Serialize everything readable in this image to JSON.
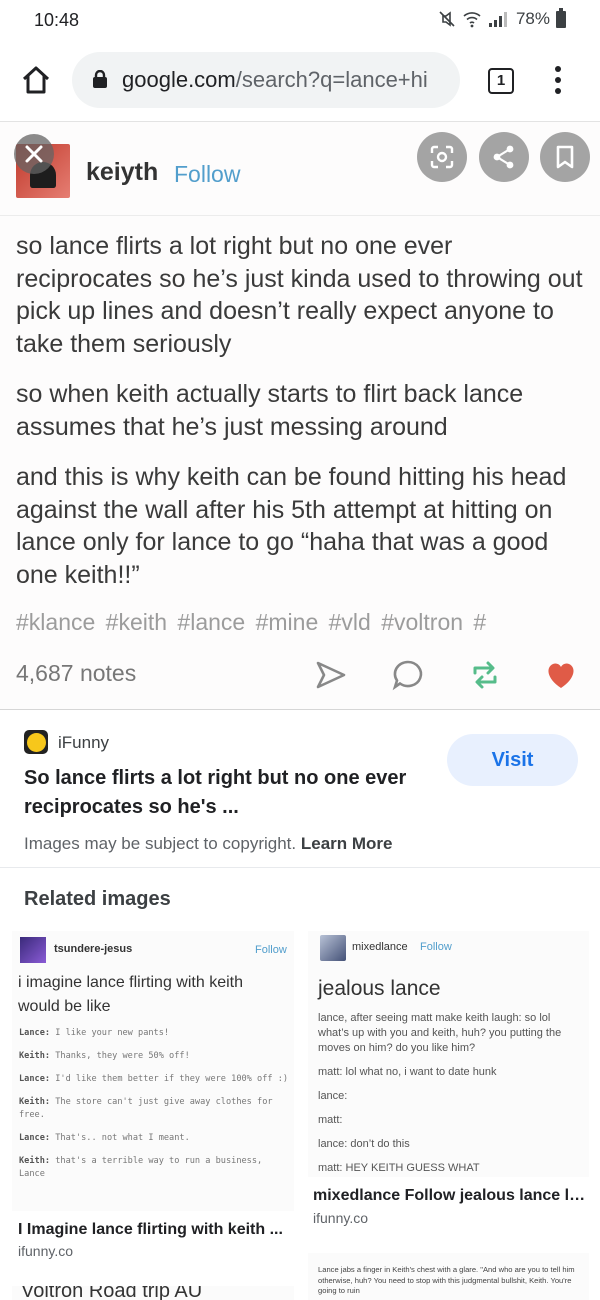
{
  "status_bar": {
    "time": "10:48",
    "battery": "78%"
  },
  "browser": {
    "url_host": "google.com",
    "url_path": "/search?q=lance+hi",
    "tab_count": "1"
  },
  "post": {
    "username": "keiyth",
    "follow_label": "Follow",
    "paragraphs": [
      "so lance flirts a lot right but no one ever reciprocates so he’s just kinda used to throwing out pick up lines and doesn’t really expect anyone to take them seriously",
      "so when keith actually starts to flirt back lance assumes that he’s just messing around",
      "and this is why keith can be found hitting his head against the wall after his 5th attempt at hitting on lance only for lance to go “haha that was a good one keith!!”"
    ],
    "tags": "#klance #keith #lance #mine #vld #voltron #",
    "notes": "4,687 notes"
  },
  "result": {
    "source": "iFunny",
    "title": "So lance flirts a lot right but no one ever reciprocates so he's ...",
    "visit_label": "Visit",
    "copyright_text": "Images may be subject to copyright.",
    "learn_more": "Learn More"
  },
  "related": {
    "heading": "Related images",
    "items": [
      {
        "user": "tsundere-jesus",
        "follow": "Follow",
        "heading": "i imagine lance flirting with keith would be like",
        "lines": [
          {
            "speaker": "Lance:",
            "text": "I like your new pants!"
          },
          {
            "speaker": "Keith:",
            "text": "Thanks, they were 50% off!"
          },
          {
            "speaker": "Lance:",
            "text": "I'd like them better if they were 100% off :)"
          },
          {
            "speaker": "Keith:",
            "text": "The store can't just give away clothes for free."
          },
          {
            "speaker": "Lance:",
            "text": "That's.. not what I meant."
          },
          {
            "speaker": "Keith:",
            "text": "that's a terrible way to run a business, Lance"
          }
        ],
        "caption": "I Imagine lance flirting with keith ...",
        "source": "ifunny.co"
      },
      {
        "user": "mixedlance",
        "follow": "Follow",
        "heading": "jealous lance",
        "lines": [
          "lance, after seeing matt make keith laugh: so lol what’s up with you and keith, huh? you putting the moves on him? do you like him?",
          "matt: lol what no, i want to date hunk",
          "lance:",
          "matt:",
          "lance: don’t do this",
          "matt: HEY KEITH GUESS WHAT"
        ],
        "caption": "mixedlance Follow jealous lance la...",
        "source": "ifunny.co"
      },
      {
        "text": "Lance jabs a finger in Keith's chest with a glare. \"And who are you to tell him otherwise, huh? You need to stop with this judgmental bullshit, Keith. You're going to ruin"
      },
      {
        "text": "Voltron Road trip AU"
      }
    ]
  },
  "colors": {
    "accent_blue": "#1a73e8",
    "tumblr_blue": "#529ecc",
    "reblog_green": "#56bc8a",
    "like_red": "#e05b47"
  }
}
